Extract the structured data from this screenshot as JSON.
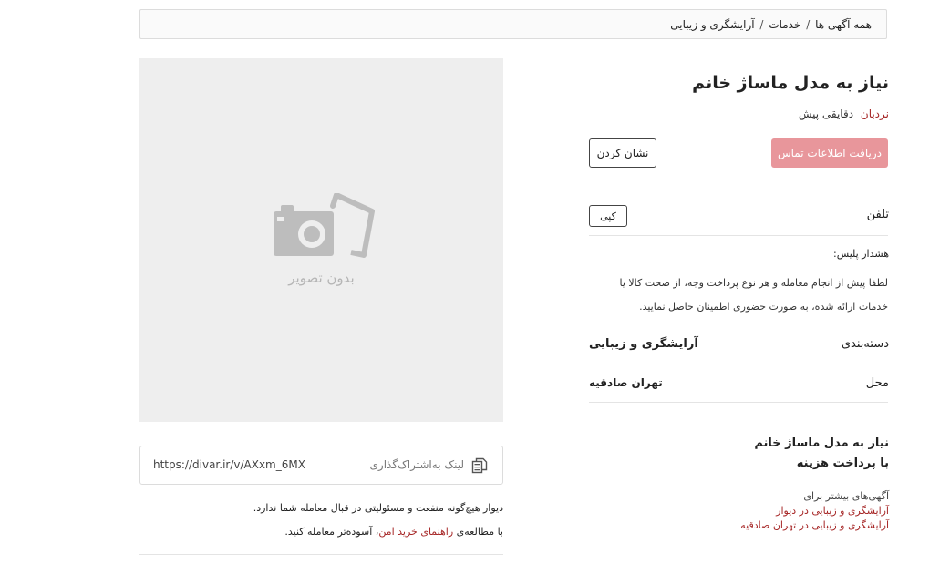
{
  "breadcrumb": {
    "items": [
      "همه آگهی ها",
      "خدمات",
      "آرایشگری و زیبایی"
    ],
    "separator": "/"
  },
  "image": {
    "placeholder_text": "بدون تصویر",
    "icon": "camera-off-icon"
  },
  "share": {
    "label": "لینک به‌اشتراک‌گذاری",
    "url": "https://divar.ir/v/AXxm_6MX",
    "icon": "copy-icon"
  },
  "disclaimer": {
    "line1": "دیوار هیچ‌گونه منفعت و مسئولیتی در قبال معامله شما ندارد.",
    "line2_prefix": "با مطالعه‌ی",
    "line2_link": "راهنمای خرید امن",
    "line2_suffix": "، آسوده‌تر معامله کنید."
  },
  "ad": {
    "title": "نیاز به مدل ماساژ خانم",
    "badge": "نردبان",
    "time_ago": "دقایقی پیش"
  },
  "actions": {
    "contact_label": "دریافت اطلاعات تماس",
    "mark_label": "نشان کردن"
  },
  "phone": {
    "label": "تلفن",
    "copy_label": "کپی"
  },
  "warning": {
    "title": "هشدار پلیس:",
    "text": "لطفا پیش از انجام معامله و هر نوع پرداخت وجه، از صحت کالا یا خدمات ارائه شده، به صورت حضوری اطمینان حاصل نمایید."
  },
  "details": {
    "category_label": "دسته‌بندی",
    "category_value": "آرایشگری و زیبایی",
    "location_label": "محل",
    "location_value": "تهران صادقیه"
  },
  "more": {
    "title_line1": "نیاز به مدل ماساژ خانم",
    "title_line2": "با پرداخت هزینه",
    "label": "آگهی‌های بیشتر برای",
    "link1": "آرایشگری و زیبایی در دیوار",
    "link2": "آرایشگری و زیبایی در تهران صادقیه"
  },
  "colors": {
    "accent_red": "#a62626",
    "contact_button": "#e8969b",
    "placeholder_bg": "#eeeeee"
  }
}
